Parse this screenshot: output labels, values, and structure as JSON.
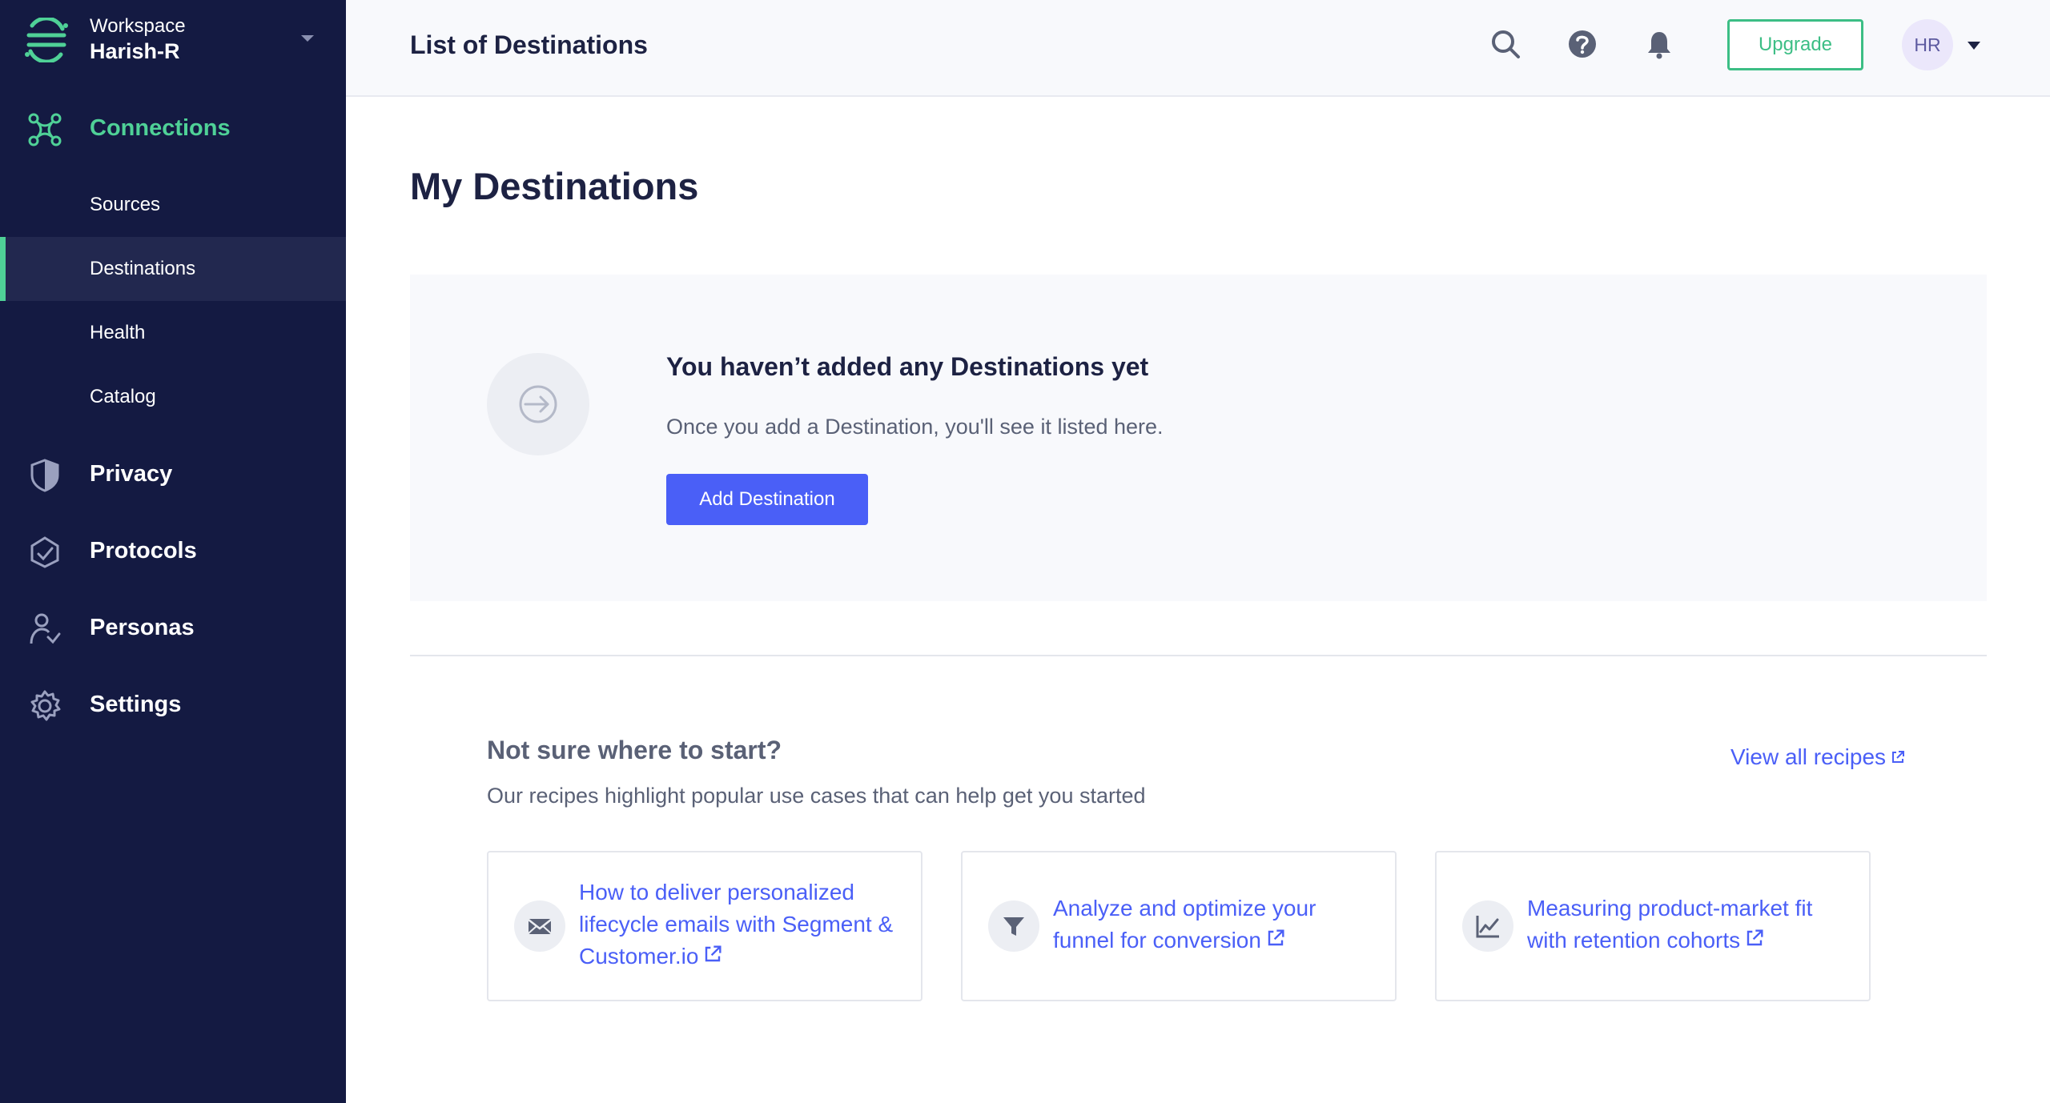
{
  "colors": {
    "sidebar_bg": "#141a42",
    "accent_green": "#4fd197",
    "primary_blue": "#4a5ff7",
    "upgrade_green": "#3cbe85"
  },
  "sidebar": {
    "workspace_caption": "Workspace",
    "workspace_name": "Harish-R",
    "nav": {
      "connections": "Connections",
      "sources": "Sources",
      "destinations": "Destinations",
      "health": "Health",
      "catalog": "Catalog",
      "privacy": "Privacy",
      "protocols": "Protocols",
      "personas": "Personas",
      "settings": "Settings"
    },
    "active_section": "Connections",
    "selected_item": "Destinations"
  },
  "topbar": {
    "title": "List of Destinations",
    "upgrade_label": "Upgrade",
    "avatar_initials": "HR",
    "icons": [
      "search-icon",
      "help-icon",
      "bell-icon"
    ]
  },
  "main": {
    "heading": "My Destinations",
    "empty_state": {
      "title": "You haven’t added any Destinations yet",
      "text": "Once you add a Destination, you'll see it listed here.",
      "button_label": "Add Destination"
    },
    "recipes": {
      "title": "Not sure where to start?",
      "subtitle": "Our recipes highlight popular use cases that can help get you started",
      "view_all_label": "View all recipes",
      "cards": [
        {
          "icon": "mail-icon",
          "title": "How to deliver personalized lifecycle emails with Segment & Customer.io"
        },
        {
          "icon": "filter-icon",
          "title": "Analyze and optimize your funnel for conversion"
        },
        {
          "icon": "line-chart-icon",
          "title": "Measuring product-market fit with retention cohorts"
        }
      ]
    }
  }
}
